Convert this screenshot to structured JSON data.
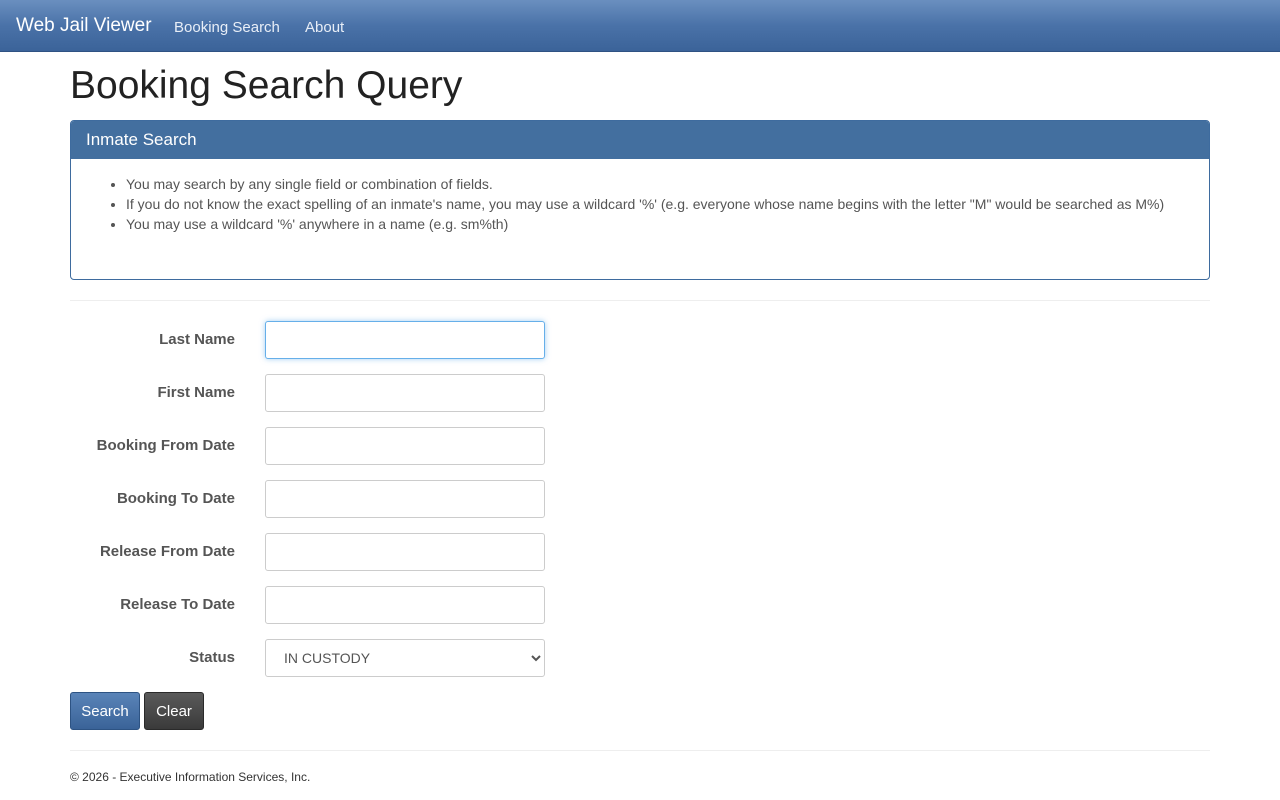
{
  "navbar": {
    "brand": "Web Jail Viewer",
    "links": [
      "Booking Search",
      "About"
    ]
  },
  "page": {
    "title": "Booking Search Query"
  },
  "panel": {
    "heading": "Inmate Search",
    "tips": [
      "You may search by any single field or combination of fields.",
      "If you do not know the exact spelling of an inmate's name, you may use a wildcard '%' (e.g. everyone whose name begins with the letter \"M\" would be searched as M%)",
      "You may use a wildcard '%' anywhere in a name (e.g. sm%th)"
    ]
  },
  "form": {
    "last_name": {
      "label": "Last Name",
      "value": ""
    },
    "first_name": {
      "label": "First Name",
      "value": ""
    },
    "booking_from": {
      "label": "Booking From Date",
      "value": ""
    },
    "booking_to": {
      "label": "Booking To Date",
      "value": ""
    },
    "release_from": {
      "label": "Release From Date",
      "value": ""
    },
    "release_to": {
      "label": "Release To Date",
      "value": ""
    },
    "status": {
      "label": "Status",
      "selected": "IN CUSTODY"
    }
  },
  "buttons": {
    "search": "Search",
    "clear": "Clear"
  },
  "footer": {
    "text": "© 2026 - Executive Information Services, Inc."
  },
  "colors": {
    "navbar": "#4a72a8",
    "panel_heading": "#436f9f",
    "search_button": "#3a6398",
    "clear_button": "#3a3a3a",
    "focus_border": "#66afe9"
  }
}
